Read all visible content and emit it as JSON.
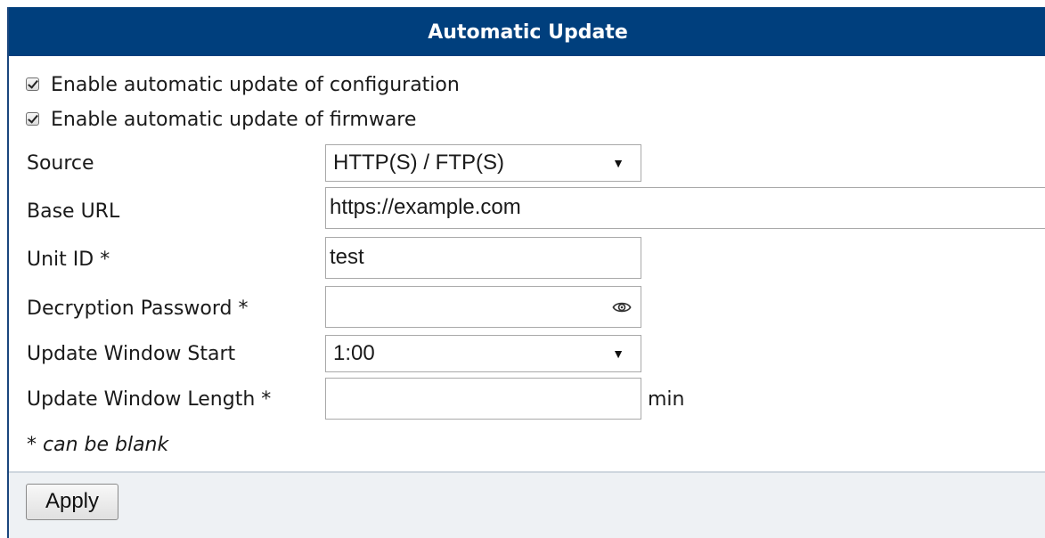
{
  "header": {
    "title": "Automatic Update"
  },
  "checkboxes": [
    {
      "label": "Enable automatic update of configuration",
      "checked": true
    },
    {
      "label": "Enable automatic update of firmware",
      "checked": true
    }
  ],
  "form": {
    "source": {
      "label": "Source",
      "value": "HTTP(S) / FTP(S)"
    },
    "base_url": {
      "label": "Base URL",
      "value": "https://example.com"
    },
    "unit_id": {
      "label": "Unit ID *",
      "value": "test"
    },
    "decryption_password": {
      "label": "Decryption Password *",
      "value": ""
    },
    "window_start": {
      "label": "Update Window Start",
      "value": "1:00"
    },
    "window_length": {
      "label": "Update Window Length *",
      "value": "",
      "unit": "min"
    }
  },
  "note": "* can be blank",
  "actions": {
    "apply_label": "Apply"
  },
  "colors": {
    "header_bg": "#003f7d",
    "header_text": "#ffffff",
    "footer_bg": "#eef1f4"
  }
}
